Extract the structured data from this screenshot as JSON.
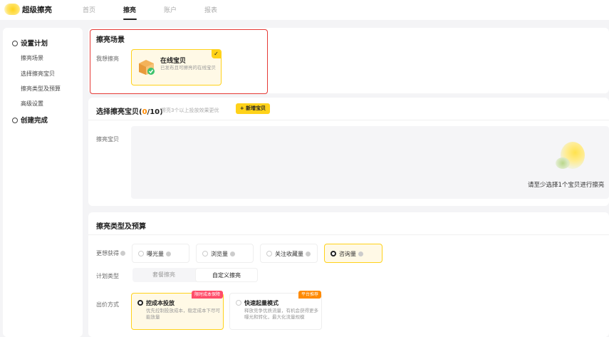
{
  "header": {
    "brand": "超级擦亮",
    "nav": [
      "首页",
      "擦亮",
      "账户",
      "报表"
    ],
    "active_nav": "擦亮"
  },
  "sidebar": {
    "section1": "设置计划",
    "items": [
      "擦亮场景",
      "选择擦亮宝贝",
      "擦亮类型及预算",
      "高级设置"
    ],
    "section2": "创建完成"
  },
  "scene": {
    "title": "擦亮场景",
    "row_label": "我想擦亮",
    "option_title": "在线宝贝",
    "option_desc": "已发布且可擦亮的在线宝贝",
    "checked": true
  },
  "items": {
    "title": "选择擦亮宝贝",
    "count_open": "(",
    "count_current": "0",
    "count_max": "/10)",
    "hint": "擦亮3个以上投放效果更优",
    "add_button": "+ 新增宝贝",
    "row_label": "擦亮宝贝",
    "empty_text": "请至少选择1个宝贝进行擦亮"
  },
  "budget": {
    "title": "擦亮类型及预算",
    "goal_label": "更想获得",
    "goals": [
      "曝光量",
      "浏览量",
      "关注收藏量",
      "咨询量"
    ],
    "selected_goal": "咨询量",
    "plan_label": "计划类型",
    "plan_types": [
      "套餐擦亮",
      "自定义擦亮"
    ],
    "active_plan": "自定义擦亮",
    "bid_label": "出价方式",
    "bids": [
      {
        "title": "控成本投放",
        "desc": "优先控制投放成本，稳定成本下尽可能放量",
        "tag": "限时成本保障"
      },
      {
        "title": "快速起量模式",
        "desc": "释放竞争优质流量，有机会获得更多曝光和转化，最大化流量规模",
        "tag": "平台推荐"
      }
    ],
    "selected_bid": "控成本投放"
  }
}
